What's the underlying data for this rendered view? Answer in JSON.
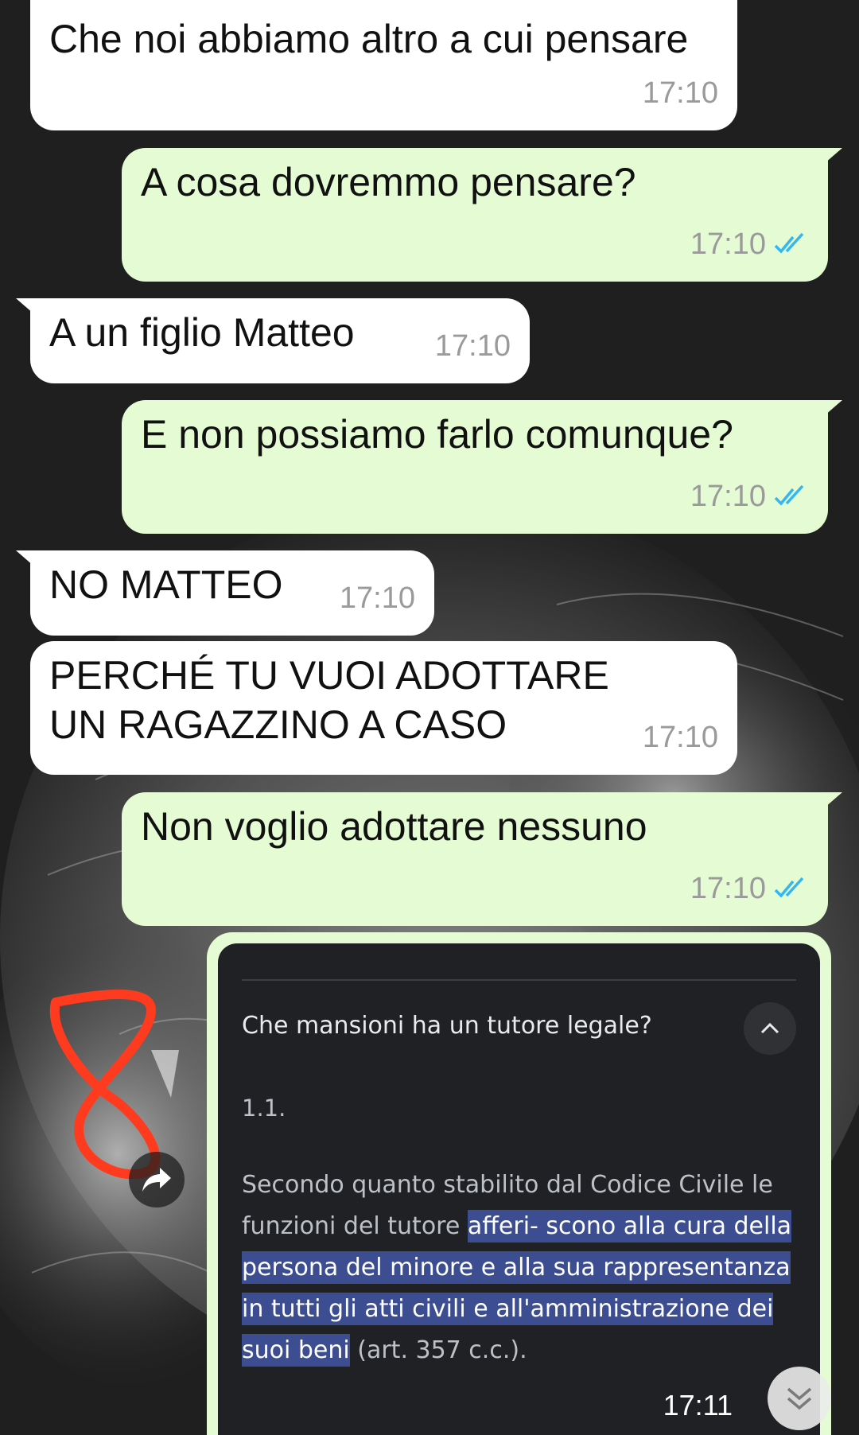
{
  "messages": [
    {
      "text": "Che noi abbiamo altro a cui pensare",
      "time": "17:10"
    },
    {
      "text": "A cosa dovremmo pensare?",
      "time": "17:10"
    },
    {
      "text": "A un figlio Matteo",
      "time": "17:10"
    },
    {
      "text": "E non possiamo farlo comunque?",
      "time": "17:10"
    },
    {
      "text": "NO MATTEO",
      "time": "17:10"
    },
    {
      "text": "PERCHÉ TU VUOI ADOTTARE UN RAGAZZINO A CASO",
      "time": "17:10"
    },
    {
      "text": "Non voglio adottare nessuno",
      "time": "17:10"
    }
  ],
  "image_message": {
    "question": "Che mansioni ha un tutore legale?",
    "number": "1.1.",
    "para_plain": "Secondo quanto stabilito dal Codice Civile le funzioni del tutore ",
    "para_highlight": "afferi- scono alla cura della persona del minore e alla sua rappresentanza in tutti gli atti civili e all'amministrazione dei suoi beni",
    "para_end": " (art. 357 c.c.).",
    "time": "17:11"
  },
  "icons": {
    "read_receipt": "double-check-icon",
    "forward": "forward-icon",
    "collapse": "chevron-up-icon",
    "scroll": "double-chevron-down-icon"
  },
  "colors": {
    "incoming": "#ffffff",
    "outgoing": "#e4fbd3",
    "read_tick": "#34b7f1",
    "highlight": "#3c4e91",
    "annotation": "#ff3b1f"
  }
}
